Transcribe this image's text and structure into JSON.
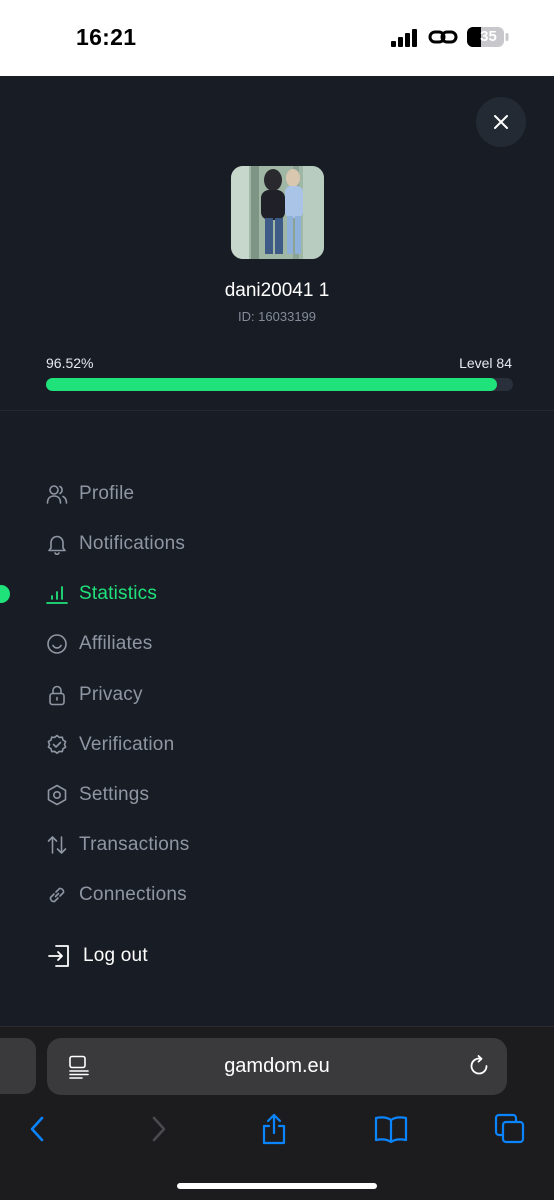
{
  "status_bar": {
    "time": "16:21",
    "battery": "35"
  },
  "profile": {
    "username": "dani20041 1",
    "user_id": "ID: 16033199",
    "progress_percent_text": "96.52%",
    "progress_fraction": 0.9652,
    "level": "Level 84"
  },
  "menu": {
    "items": [
      {
        "label": "Profile",
        "icon": "users-icon",
        "active": false
      },
      {
        "label": "Notifications",
        "icon": "bell-icon",
        "active": false
      },
      {
        "label": "Statistics",
        "icon": "bar-chart-icon",
        "active": true
      },
      {
        "label": "Affiliates",
        "icon": "smile-icon",
        "active": false
      },
      {
        "label": "Privacy",
        "icon": "lock-icon",
        "active": false
      },
      {
        "label": "Verification",
        "icon": "badge-check-icon",
        "active": false
      },
      {
        "label": "Settings",
        "icon": "hexagon-settings-icon",
        "active": false
      },
      {
        "label": "Transactions",
        "icon": "arrows-up-down-icon",
        "active": false
      },
      {
        "label": "Connections",
        "icon": "link-icon",
        "active": false
      }
    ],
    "logout_label": "Log out"
  },
  "browser": {
    "url": "gamdom.eu"
  },
  "colors": {
    "panel_bg": "#181c24",
    "accent_green": "#1fe27a",
    "menu_text": "#8f96a3",
    "safari_bg": "#1c1c1e",
    "safari_blue": "#0a84ff"
  }
}
